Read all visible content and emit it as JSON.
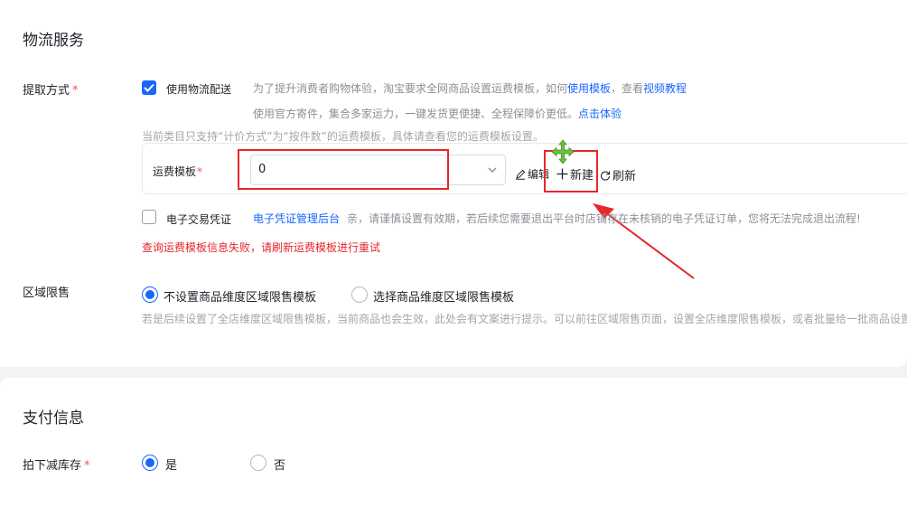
{
  "logistics": {
    "section_title": "物流服务",
    "pickup": {
      "label": "提取方式",
      "required_mark": "*",
      "use_logistics_label": "使用物流配送",
      "use_logistics_checked": true,
      "hint1_prefix": "为了提升消费者购物体验，淘宝要求全网商品设置运费模板，如何",
      "hint1_link1": "使用模板",
      "hint1_mid": "，查看",
      "hint1_link2": "视频教程",
      "hint2_prefix": "使用官方寄件，集合多家运力，一键发货更便捷、全程保障价更低。",
      "hint2_link": "点击体验",
      "notice": "当前类目只支持“计价方式”为“按件数”的运费模板，具体请查看您的运费模板设置。"
    },
    "template": {
      "label": "运费模板",
      "required_mark": "*",
      "value": "0",
      "edit_label": "编辑",
      "new_label": "新建",
      "refresh_label": "刷新"
    },
    "voucher": {
      "label": "电子交易凭证",
      "checked": false,
      "link": "电子凭证管理后台",
      "text": "亲，请谨慎设置有效期，若后续您需要退出平台时店铺存在未核销的电子凭证订单，您将无法完成退出流程!"
    },
    "error": "查询运费模板信息失败，请刷新运费模板进行重试"
  },
  "region": {
    "label": "区域限售",
    "option_none": "不设置商品维度区域限售模板",
    "option_select": "选择商品维度区域限售模板",
    "selected": "none",
    "hint": "若是后续设置了全店维度区域限售模板，当前商品也会生效，此处会有文案进行提示。可以前往区域限售页面，设置全店维度限售模板，或者批量给一批商品设置"
  },
  "payment": {
    "section_title": "支付信息",
    "stock": {
      "label": "拍下减库存",
      "required_mark": "*",
      "yes": "是",
      "no": "否",
      "selected": "yes"
    }
  },
  "colors": {
    "accent": "#1966ff",
    "annotation_red": "#e8262b",
    "error": "#e5262c",
    "move_cursor": "#6fbf3a"
  }
}
